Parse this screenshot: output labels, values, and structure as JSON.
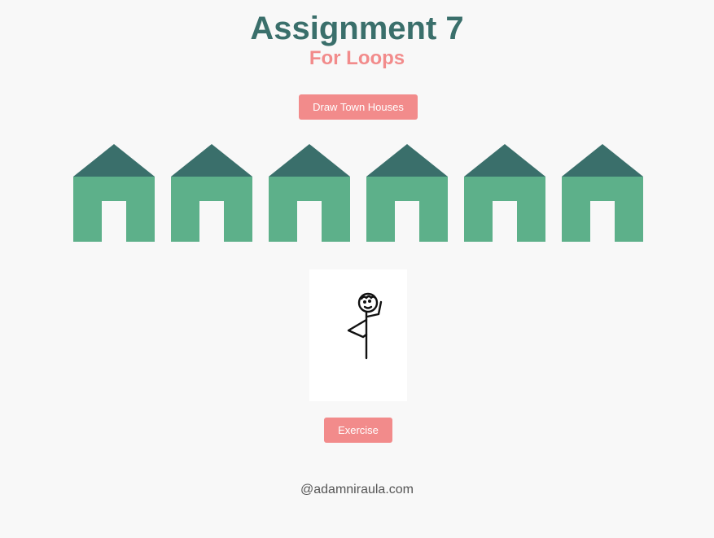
{
  "header": {
    "title": "Assignment 7",
    "subtitle": "For Loops"
  },
  "buttons": {
    "draw_town_houses": "Draw Town Houses",
    "exercise": "Exercise"
  },
  "houses": {
    "count": 6,
    "roof_color": "#3a6f6b",
    "wall_color": "#5db08a",
    "door_color": "#f8f8f8"
  },
  "footer": {
    "credit": "@adamniraula.com"
  },
  "colors": {
    "title": "#3a6f6b",
    "accent": "#f28b8b",
    "background": "#f8f8f8"
  }
}
